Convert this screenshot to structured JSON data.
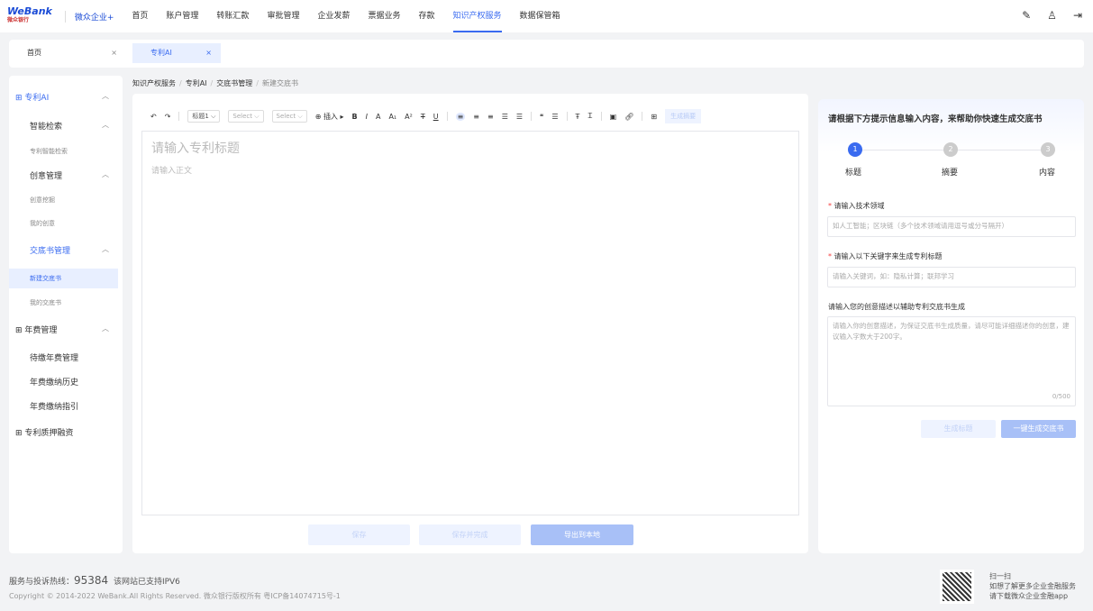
{
  "header": {
    "logo": "WeBank",
    "logo_sub": "微众银行",
    "brand": "微众企业+",
    "nav": [
      "首页",
      "账户管理",
      "转账汇款",
      "审批管理",
      "企业发薪",
      "票据业务",
      "存款",
      "知识产权服务",
      "数据保管箱"
    ],
    "active_nav": "知识产权服务"
  },
  "tabs": [
    {
      "label": "首页"
    },
    {
      "label": "专利AI"
    }
  ],
  "sidebar": {
    "items": [
      {
        "label": "专利AI",
        "level": "top"
      },
      {
        "label": "智能检索",
        "level": "group"
      },
      {
        "label": "专利智能检索",
        "level": "sub"
      },
      {
        "label": "创意管理",
        "level": "group"
      },
      {
        "label": "创意挖掘",
        "level": "sub"
      },
      {
        "label": "我的创意",
        "level": "sub"
      },
      {
        "label": "交底书管理",
        "level": "group"
      },
      {
        "label": "新建交底书",
        "level": "sub"
      },
      {
        "label": "我的交底书",
        "level": "sub"
      },
      {
        "label": "年费管理",
        "level": "top"
      },
      {
        "label": "待缴年费管理",
        "level": "group"
      },
      {
        "label": "年费缴纳历史",
        "level": "group"
      },
      {
        "label": "年费缴纳指引",
        "level": "group"
      },
      {
        "label": "专利质押融资",
        "level": "top"
      }
    ]
  },
  "breadcrumb": [
    "知识产权服务",
    "专利AI",
    "交底书管理",
    "新建交底书"
  ],
  "toolbar": {
    "heading": "标题1",
    "select1": "Select",
    "select2": "Select",
    "insert": "插入",
    "generate": "生成摘要"
  },
  "editor": {
    "title_placeholder": "请输入专利标题",
    "body_placeholder": "请输入正文"
  },
  "actions": {
    "save": "保存",
    "save_complete": "保存并完成",
    "export": "导出到本地"
  },
  "assistant": {
    "title": "请根据下方提示信息输入内容，来帮助你快速生成交底书",
    "steps": [
      {
        "num": "1",
        "label": "标题"
      },
      {
        "num": "2",
        "label": "摘要"
      },
      {
        "num": "3",
        "label": "内容"
      }
    ],
    "field1_label": "请输入技术领域",
    "field1_placeholder": "如人工智能；区块链（多个技术领域请用逗号或分号隔开）",
    "field2_label": "请输入以下关键字来生成专利标题",
    "field2_placeholder": "请输入关键词，如：隐私计算；联邦学习",
    "field3_label": "请输入您的创意描述以辅助专利交底书生成",
    "field3_placeholder": "请输入你的创意描述，为保证交底书生成质量，请尽可能详细描述你的创意，建议输入字数大于200字。",
    "counter": "0/500",
    "btn_title": "生成标题",
    "btn_all": "一键生成交底书"
  },
  "footer": {
    "hotline_label": "服务与投诉热线：",
    "hotline": "95384",
    "ipv6": "该网站已支持IPV6",
    "copyright": "Copyright © 2014-2022 WeBank.All Rights Reserved. 微众银行版权所有 粤ICP备14074715号-1",
    "scan": "扫一扫",
    "more": "如想了解更多企业金融服务",
    "download": "请下载微众企业金融app"
  }
}
